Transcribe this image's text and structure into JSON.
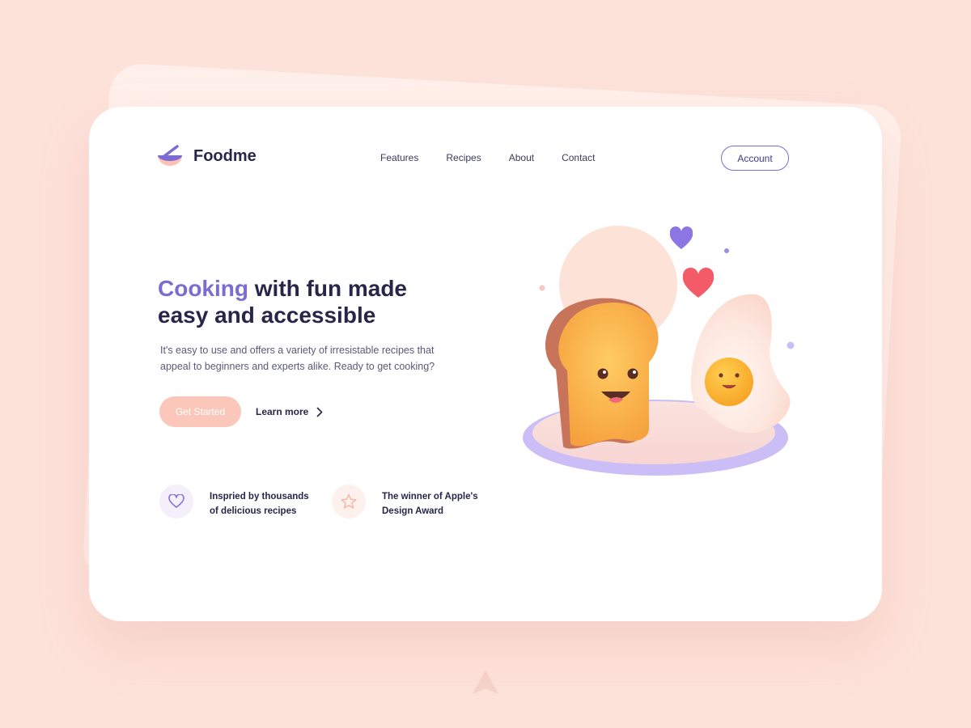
{
  "brand": {
    "name": "Foodme"
  },
  "nav": {
    "items": [
      "Features",
      "Recipes",
      "About",
      "Contact"
    ]
  },
  "header": {
    "account_label": "Account"
  },
  "hero": {
    "headline_accent": "Cooking",
    "headline_rest": " with fun made",
    "headline_line2": "easy and accessible",
    "subtext_line1": "It's easy to use and offers a variety of irresistable recipes that",
    "subtext_line2": "appeal to beginners and experts alike. Ready to get cooking?",
    "primary_cta": "Get Started",
    "secondary_cta": "Learn more"
  },
  "features": [
    {
      "line1": "Inspried by thousands",
      "line2": "of delicious recipes",
      "icon": "heart-outline-icon"
    },
    {
      "line1": "The winner of Apple's",
      "line2": "Design Award",
      "icon": "star-outline-icon"
    }
  ],
  "colors": {
    "background": "#fde2da",
    "accent": "#7b6bd2",
    "text_dark": "#27264a",
    "cta": "#fbc7bb"
  }
}
